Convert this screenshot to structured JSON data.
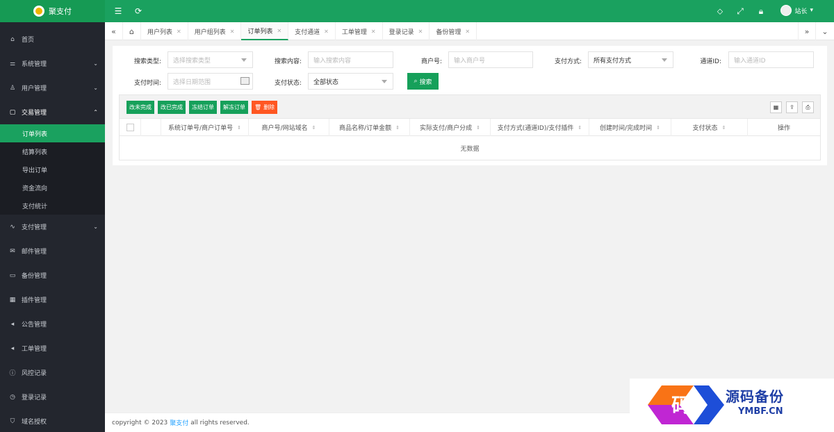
{
  "app": {
    "name": "聚支付"
  },
  "header": {
    "user": "站长"
  },
  "sidebar": {
    "items": [
      {
        "label": "首页",
        "icon": "home-icon"
      },
      {
        "label": "系统管理",
        "icon": "settings-icon"
      },
      {
        "label": "用户管理",
        "icon": "user-icon"
      },
      {
        "label": "交易管理",
        "icon": "document-icon"
      },
      {
        "label": "支付管理",
        "icon": "pulse-icon"
      },
      {
        "label": "邮件管理",
        "icon": "mail-icon"
      },
      {
        "label": "备份管理",
        "icon": "backup-icon"
      },
      {
        "label": "插件管理",
        "icon": "plugin-icon"
      },
      {
        "label": "公告管理",
        "icon": "announce-icon"
      },
      {
        "label": "工单管理",
        "icon": "ticket-icon"
      },
      {
        "label": "风控记录",
        "icon": "risk-icon"
      },
      {
        "label": "登录记录",
        "icon": "clock-icon"
      },
      {
        "label": "域名授权",
        "icon": "shield-icon"
      }
    ],
    "sub": [
      "订单列表",
      "结算列表",
      "导出订单",
      "资金流向",
      "支付统计"
    ]
  },
  "tabs": [
    "用户列表",
    "用户组列表",
    "订单列表",
    "支付通道",
    "工单管理",
    "登录记录",
    "备份管理"
  ],
  "filters": {
    "search_type_label": "搜索类型:",
    "search_type_placeholder": "选择搜索类型",
    "search_content_label": "搜索内容:",
    "search_content_placeholder": "输入搜索内容",
    "merchant_label": "商户号:",
    "merchant_placeholder": "输入商户号",
    "pay_method_label": "支付方式:",
    "pay_method_value": "所有支付方式",
    "channel_label": "通道ID:",
    "channel_placeholder": "输入通道ID",
    "pay_time_label": "支付时间:",
    "pay_time_placeholder": "选择日期范围",
    "pay_status_label": "支付状态:",
    "pay_status_value": "全部状态",
    "search_button": "搜索"
  },
  "toolbar": {
    "buttons": [
      "改未完成",
      "改已完成",
      "冻结订单",
      "解冻订单"
    ],
    "delete": "删除"
  },
  "table": {
    "columns": [
      "系统订单号/商户订单号",
      "商户号/网站域名",
      "商品名称/订单金额",
      "实际支付/商户分成",
      "支付方式(通道ID)/支付插件",
      "创建时间/完成时间",
      "支付状态",
      "操作"
    ],
    "empty": "无数据"
  },
  "footer": {
    "prefix": "copyright © 2023",
    "brand": "聚支付",
    "suffix": "all rights reserved."
  },
  "watermark": {
    "glyph": "码",
    "title": "源码备份",
    "url": "YMBF.CN"
  },
  "colors": {
    "primary": "#1aa15f",
    "sidebar": "#23262e",
    "danger": "#ff5722",
    "link": "#1e9fff"
  }
}
